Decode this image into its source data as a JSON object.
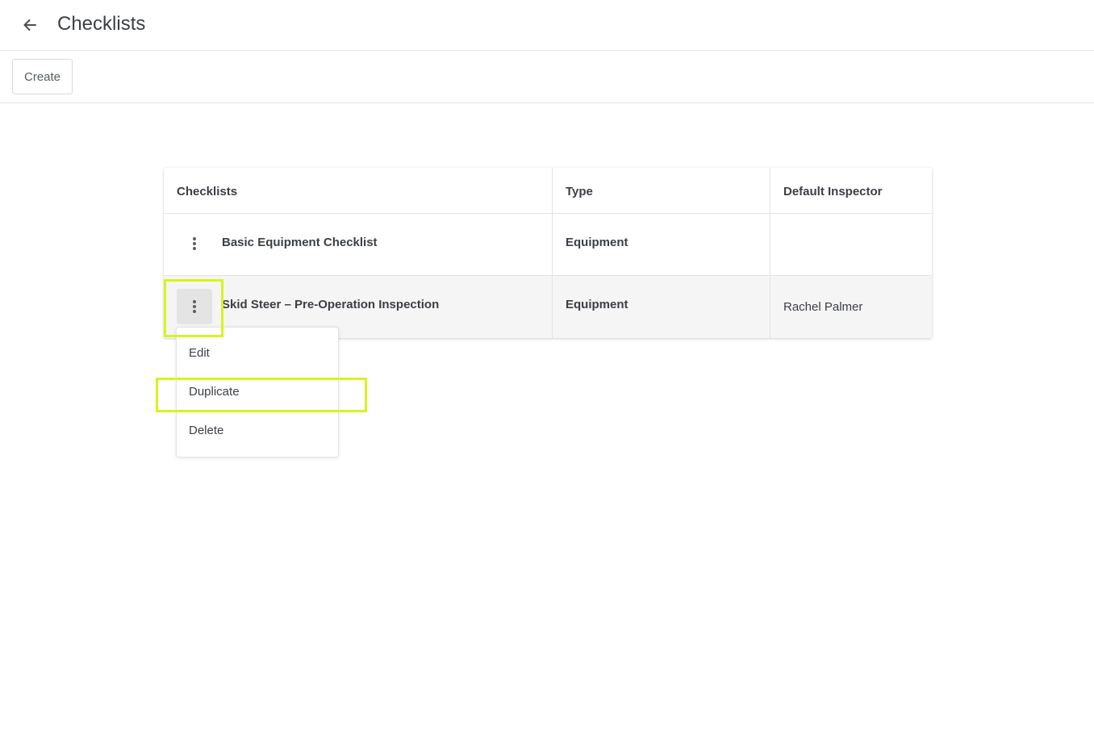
{
  "header": {
    "back_icon": "arrow-left-icon",
    "title": "Checklists"
  },
  "toolbar": {
    "create_label": "Create"
  },
  "table": {
    "columns": [
      "Checklists",
      "Type",
      "Default Inspector"
    ],
    "rows": [
      {
        "menu_icon": "more-vertical-icon",
        "name": "Basic Equipment Checklist",
        "type": "Equipment",
        "default_inspector": ""
      },
      {
        "menu_icon": "more-vertical-icon",
        "name": "Skid Steer – Pre-Operation Inspection",
        "type": "Equipment",
        "default_inspector": "Rachel Palmer"
      }
    ]
  },
  "row_menu": {
    "items": [
      "Edit",
      "Duplicate",
      "Delete"
    ]
  },
  "colors": {
    "highlight": "#d8f320",
    "text": "#3b3f45",
    "selected_row_bg": "#f5f5f5",
    "active_button_bg": "#e4e4e4"
  }
}
